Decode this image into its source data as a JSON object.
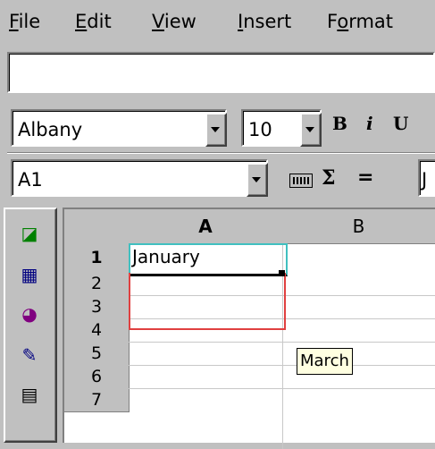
{
  "menu": {
    "file": {
      "u": "F",
      "rest": "ile"
    },
    "edit": {
      "u": "E",
      "rest": "dit"
    },
    "view": {
      "u": "V",
      "rest": "iew"
    },
    "insert": {
      "u": "I",
      "rest": "nsert"
    },
    "format": {
      "pre": "F",
      "u": "o",
      "rest": "rmat"
    }
  },
  "edit_line": {
    "value": ""
  },
  "format_toolbar": {
    "font": "Albany",
    "size": "10",
    "bold": "B",
    "italic": "i",
    "underline": "U"
  },
  "formula_bar": {
    "cell_ref": "A1",
    "sum_symbol": "Σ",
    "equals_symbol": "=",
    "content": "J"
  },
  "sheet": {
    "columns": [
      "A",
      "B"
    ],
    "rows": [
      "1",
      "2",
      "3",
      "4",
      "5",
      "6",
      "7"
    ],
    "cells": {
      "A1": "January"
    },
    "tooltip": "March",
    "active_cell": "A1"
  },
  "side_toolbar": {
    "icons": [
      "chart-insert-icon",
      "table-insert-icon",
      "pie-chart-icon",
      "draw-edit-icon",
      "form-edit-icon"
    ]
  }
}
